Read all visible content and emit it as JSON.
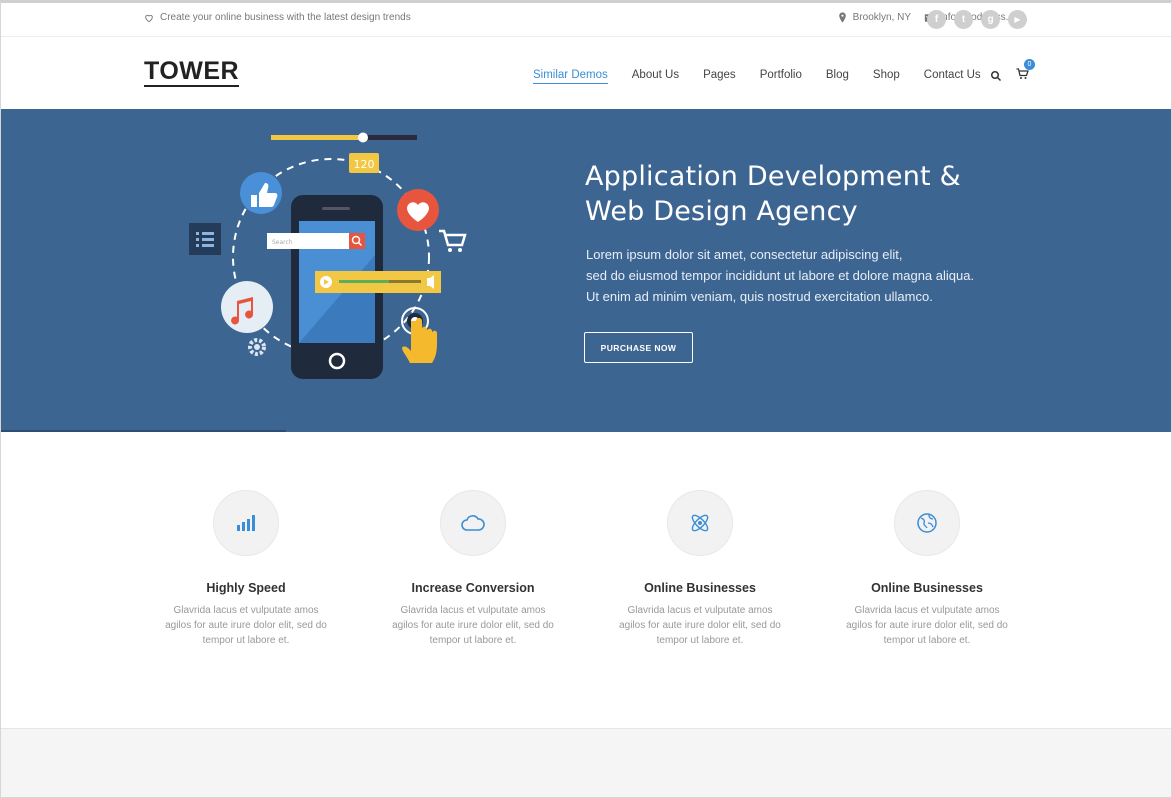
{
  "topbar": {
    "tagline": "Create your online business with the latest design trends",
    "location": "Brooklyn, NY",
    "email": "info@codeless.co",
    "socials": [
      {
        "icon": "facebook-icon",
        "glyph": "f"
      },
      {
        "icon": "twitter-icon",
        "glyph": "t"
      },
      {
        "icon": "googleplus-icon",
        "glyph": "g"
      },
      {
        "icon": "youtube-icon",
        "glyph": "▶"
      }
    ]
  },
  "header": {
    "logo": "TOWER",
    "nav": [
      "Similar Demos",
      "About Us",
      "Pages",
      "Portfolio",
      "Blog",
      "Shop",
      "Contact Us"
    ],
    "active_nav": "Similar Demos",
    "cart_count": "0"
  },
  "hero": {
    "title_line1": "Application Development &",
    "title_line2": "Web Design Agency",
    "lead": [
      "Lorem ipsum dolor sit amet, consectetur adipiscing elit,",
      "sed do eiusmod tempor incididunt ut labore et dolore magna aliqua.",
      "Ut enim ad minim veniam, quis nostrud exercitation ullamco."
    ],
    "cta": "PURCHASE NOW",
    "illustration": {
      "badge": "120",
      "search_placeholder": "Search"
    },
    "bg_color": "#3d6592"
  },
  "features": [
    {
      "icon": "bar-chart-icon",
      "title": "Highly Speed",
      "text": [
        "Glavrida lacus et vulputate amos",
        "agilos for aute irure dolor elit, sed do",
        "tempor ut labore et."
      ]
    },
    {
      "icon": "cloud-icon",
      "title": "Increase Conversion",
      "text": [
        "Glavrida lacus et vulputate amos",
        "agilos for aute irure dolor elit, sed do",
        "tempor ut labore et."
      ]
    },
    {
      "icon": "atom-icon",
      "title": "Online Businesses",
      "text": [
        "Glavrida lacus et vulputate amos",
        "agilos for aute irure dolor elit, sed do",
        "tempor ut labore et."
      ]
    },
    {
      "icon": "globe-icon",
      "title": "Online Businesses",
      "text": [
        "Glavrida lacus et vulputate amos",
        "agilos for aute irure dolor elit, sed do",
        "tempor ut labore et."
      ]
    }
  ],
  "colors": {
    "accent": "#3a8dd6",
    "hero": "#3d6592"
  }
}
